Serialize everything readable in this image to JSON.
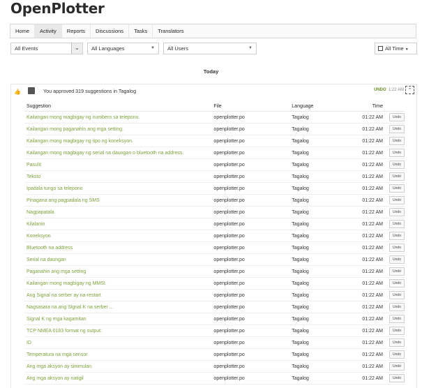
{
  "app": {
    "title": "OpenPlotter"
  },
  "tabs": [
    {
      "label": "Home"
    },
    {
      "label": "Activity"
    },
    {
      "label": "Reports"
    },
    {
      "label": "Discussions"
    },
    {
      "label": "Tasks"
    },
    {
      "label": "Translators"
    }
  ],
  "filters": {
    "events": "All Events",
    "languages": "All Languages",
    "users": "All Users",
    "time": "All Time"
  },
  "day_header": "Today",
  "event": {
    "message": "You approved 319 suggestions in Tagalog",
    "undo_label": "UNDO",
    "time": "1:22 AM"
  },
  "table": {
    "columns": [
      "Suggestion",
      "File",
      "Language",
      "Time"
    ],
    "undo_label": "Undo",
    "rows": [
      {
        "suggestion": "Kailangan mong magbigay ng numbero sa telepono.",
        "file": "openplotter.po",
        "language": "Tagalog",
        "time": "01:22 AM"
      },
      {
        "suggestion": "Kailangan mong paganahin ang mga setting.",
        "file": "openplotter.po",
        "language": "Tagalog",
        "time": "01:22 AM"
      },
      {
        "suggestion": "Kailangan mong magbigay ng tipo ng koneksyon.",
        "file": "openplotter.po",
        "language": "Tagalog",
        "time": "01:22 AM"
      },
      {
        "suggestion": "Kailangan mong magbigay ng serial na daungan o bluetooth na address.",
        "file": "openplotter.po",
        "language": "Tagalog",
        "time": "01:22 AM"
      },
      {
        "suggestion": "Pasulit",
        "file": "openplotter.po",
        "language": "Tagalog",
        "time": "01:22 AM"
      },
      {
        "suggestion": "Teksto",
        "file": "openplotter.po",
        "language": "Tagalog",
        "time": "01:22 AM"
      },
      {
        "suggestion": "Ipadala tungo sa telepono",
        "file": "openplotter.po",
        "language": "Tagalog",
        "time": "01:22 AM"
      },
      {
        "suggestion": "Pinagana ang pagpadala ng SMS",
        "file": "openplotter.po",
        "language": "Tagalog",
        "time": "01:22 AM"
      },
      {
        "suggestion": "Nagpapatala",
        "file": "openplotter.po",
        "language": "Tagalog",
        "time": "01:22 AM"
      },
      {
        "suggestion": "Kilalanin",
        "file": "openplotter.po",
        "language": "Tagalog",
        "time": "01:22 AM"
      },
      {
        "suggestion": "Koneksyon",
        "file": "openplotter.po",
        "language": "Tagalog",
        "time": "01:22 AM"
      },
      {
        "suggestion": "Bluetooth na address",
        "file": "openplotter.po",
        "language": "Tagalog",
        "time": "01:22 AM"
      },
      {
        "suggestion": "Serial na daungan",
        "file": "openplotter.po",
        "language": "Tagalog",
        "time": "01:22 AM"
      },
      {
        "suggestion": "Paganahin ang mga setting",
        "file": "openplotter.po",
        "language": "Tagalog",
        "time": "01:22 AM"
      },
      {
        "suggestion": "Kailangan mong magbigay ng MMSI.",
        "file": "openplotter.po",
        "language": "Tagalog",
        "time": "01:22 AM"
      },
      {
        "suggestion": "Ang Signal na serber ay na-restart",
        "file": "openplotter.po",
        "language": "Tagalog",
        "time": "01:22 AM"
      },
      {
        "suggestion": "Nagsasara na ang Signal K na serber ...",
        "file": "openplotter.po",
        "language": "Tagalog",
        "time": "01:22 AM"
      },
      {
        "suggestion": "Signal K ng mga kagamitan",
        "file": "openplotter.po",
        "language": "Tagalog",
        "time": "01:22 AM"
      },
      {
        "suggestion": "TCP NMEA 0183 format ng output:",
        "file": "openplotter.po",
        "language": "Tagalog",
        "time": "01:22 AM"
      },
      {
        "suggestion": "ID",
        "file": "openplotter.po",
        "language": "Tagalog",
        "time": "01:22 AM"
      },
      {
        "suggestion": "Temperatura na mga sensor",
        "file": "openplotter.po",
        "language": "Tagalog",
        "time": "01:22 AM"
      },
      {
        "suggestion": "Ang mga aksyon ay sinimulan",
        "file": "openplotter.po",
        "language": "Tagalog",
        "time": "01:22 AM"
      },
      {
        "suggestion": "Ang mga aksyon ay natigil",
        "file": "openplotter.po",
        "language": "Tagalog",
        "time": "01:22 AM"
      }
    ]
  }
}
